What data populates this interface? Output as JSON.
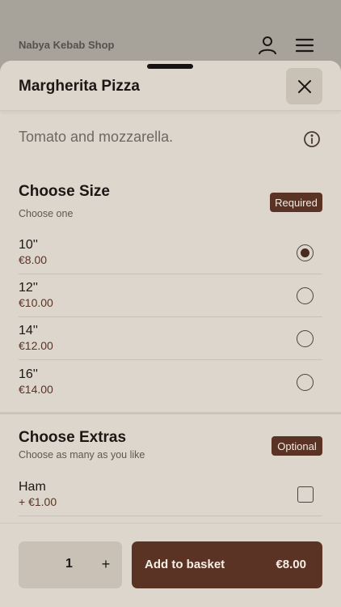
{
  "app": {
    "shop_name": "Nabya Kebab Shop",
    "user_icon": "user-icon",
    "menu_icon": "hamburger-menu-icon"
  },
  "sheet": {
    "title": "Margherita Pizza",
    "close_icon": "close-icon",
    "description": "Tomato and mozzarella.",
    "info_icon": "info-icon"
  },
  "size_section": {
    "title": "Choose Size",
    "subtitle": "Choose one",
    "badge": "Required",
    "options": [
      {
        "label": "10''",
        "price": "€8.00",
        "selected": true
      },
      {
        "label": "12''",
        "price": "€10.00",
        "selected": false
      },
      {
        "label": "14''",
        "price": "€12.00",
        "selected": false
      },
      {
        "label": "16''",
        "price": "€14.00",
        "selected": false
      }
    ]
  },
  "extras_section": {
    "title": "Choose Extras",
    "subtitle": "Choose as many as you like",
    "badge": "Optional",
    "options": [
      {
        "label": "Ham",
        "price": "+ €1.00",
        "checked": false
      }
    ]
  },
  "footer": {
    "quantity": "1",
    "plus": "+",
    "add_label": "Add to basket",
    "total": "€8.00"
  },
  "colors": {
    "accent": "#5a3324",
    "sheet_bg": "#ddd6cc",
    "button_bg": "#c9c1b6"
  }
}
